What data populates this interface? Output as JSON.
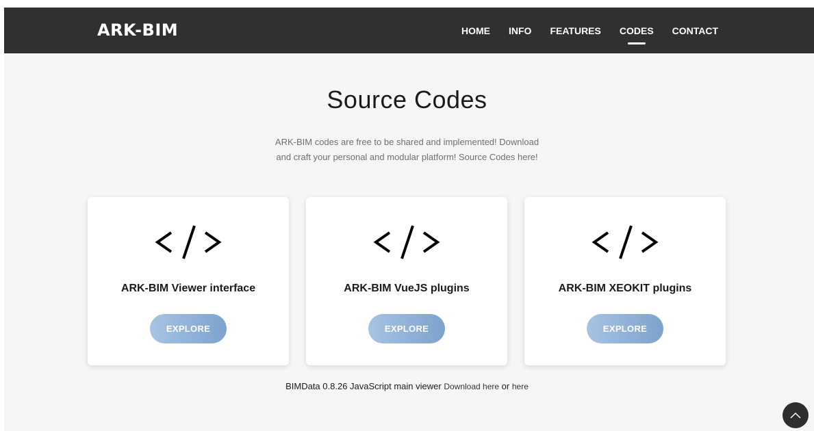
{
  "header": {
    "logo": "ARK-BIM",
    "nav": [
      {
        "label": "HOME",
        "active": false
      },
      {
        "label": "INFO",
        "active": false
      },
      {
        "label": "FEATURES",
        "active": false
      },
      {
        "label": "CODES",
        "active": true
      },
      {
        "label": "CONTACT",
        "active": false
      }
    ]
  },
  "main": {
    "title": "Source Codes",
    "subtitle_line1": "ARK-BIM codes are free to be shared and implemented! Download",
    "subtitle_line2": "and craft your personal and modular platform! Source Codes here!",
    "cards": [
      {
        "icon": "code-icon",
        "title": "ARK-BIM Viewer interface",
        "button": "EXPLORE"
      },
      {
        "icon": "code-icon",
        "title": "ARK-BIM VueJS plugins",
        "button": "EXPLORE"
      },
      {
        "icon": "code-icon",
        "title": "ARK-BIM XEOKIT plugins",
        "button": "EXPLORE"
      }
    ]
  },
  "footer": {
    "text": "BIMData 0.8.26 JavaScript main viewer",
    "link1": "Download here",
    "or": "or",
    "link2": "here"
  },
  "colors": {
    "navbar": "#303030",
    "background": "#f6f6f6",
    "button_start": "#a8c3e3",
    "button_end": "#7da2cd"
  }
}
